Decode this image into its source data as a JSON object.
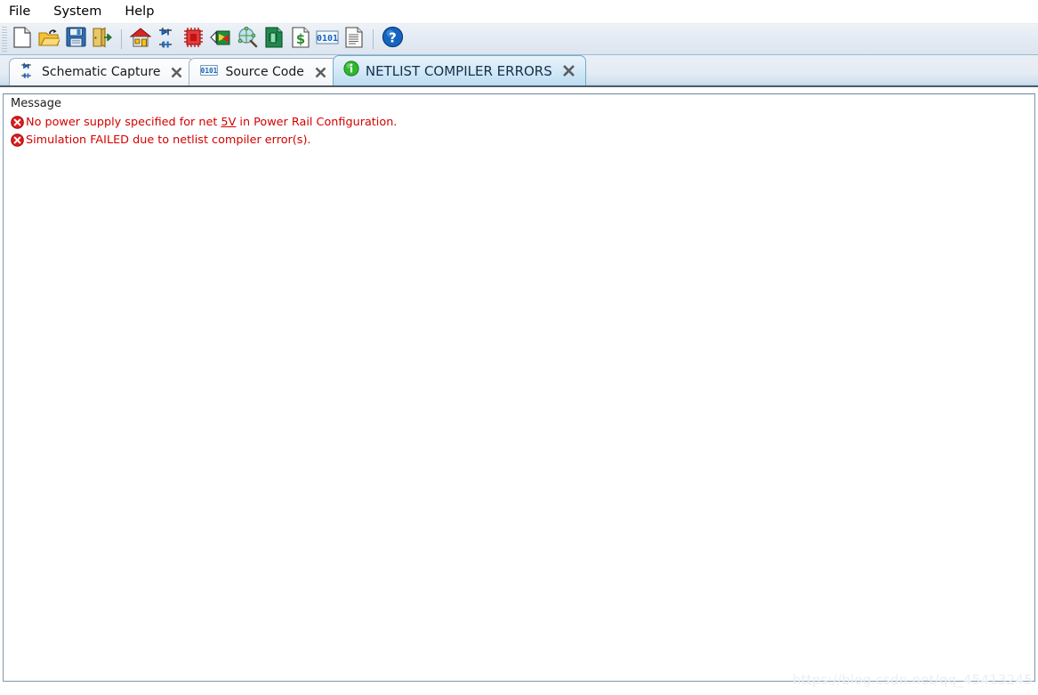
{
  "menubar": {
    "items": [
      {
        "label": "File",
        "name": "menu-file"
      },
      {
        "label": "System",
        "name": "menu-system"
      },
      {
        "label": "Help",
        "name": "menu-help"
      }
    ]
  },
  "toolbar": {
    "buttons": [
      {
        "icon": "new-document-icon",
        "title": "New"
      },
      {
        "icon": "open-folder-icon",
        "title": "Open"
      },
      {
        "icon": "save-floppy-icon",
        "title": "Save"
      },
      {
        "icon": "exit-door-icon",
        "title": "Exit"
      },
      {
        "icon": "home-house-icon",
        "title": "Home"
      },
      {
        "icon": "schematic-capture-icon",
        "title": "Schematic Capture"
      },
      {
        "icon": "pcb-chip-icon",
        "title": "PCB Layout"
      },
      {
        "icon": "3d-visualizer-icon",
        "title": "3D Visualizer"
      },
      {
        "icon": "design-explorer-icon",
        "title": "Design Explorer"
      },
      {
        "icon": "gerber-viewer-icon",
        "title": "Gerber Viewer"
      },
      {
        "icon": "bill-of-materials-icon",
        "title": "Bill of Materials"
      },
      {
        "icon": "source-code-icon",
        "title": "Source Code"
      },
      {
        "icon": "report-document-icon",
        "title": "Report"
      },
      {
        "icon": "help-question-icon",
        "title": "Help"
      }
    ],
    "separator_after": [
      3,
      12
    ]
  },
  "tabs": [
    {
      "label": "Schematic Capture",
      "icon": "schematic-capture-icon",
      "active": false,
      "close_label": "✕"
    },
    {
      "label": "Source Code",
      "icon": "source-code-icon",
      "active": false,
      "close_label": "✕"
    },
    {
      "label": "NETLIST COMPILER ERRORS",
      "icon": "info-circle-icon",
      "active": true,
      "close_label": "✕"
    }
  ],
  "message_pane": {
    "column_header": "Message",
    "rows": [
      {
        "icon": "error-circle-icon",
        "prefix": "No power supply specified for net ",
        "link": "5V",
        "suffix": " in Power Rail Configuration."
      },
      {
        "icon": "error-circle-icon",
        "prefix": "Simulation FAILED due to netlist compiler error(s).",
        "link": "",
        "suffix": ""
      }
    ]
  },
  "watermark": {
    "text": "https://blog.csdn.net/qq_45413245"
  },
  "colors": {
    "error_text": "#d40000",
    "toolbar_bg": "#e3eaf3",
    "active_tab": "#bcdcf2",
    "tabstrip_rule": "#4e5b66"
  }
}
